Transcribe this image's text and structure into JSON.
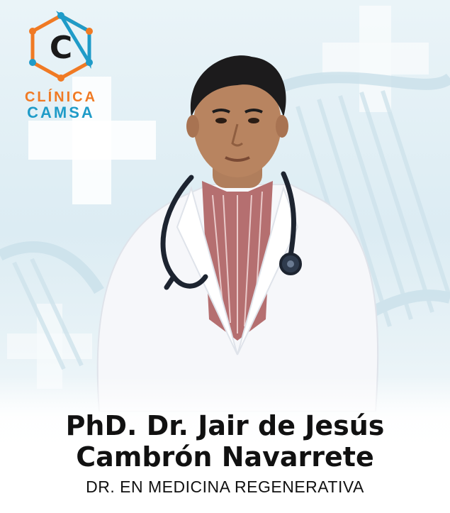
{
  "logo": {
    "letter": "C",
    "line1": "CLÍNICA",
    "line2": "CAMSA",
    "colors": {
      "orange": "#f07a24",
      "blue": "#1f9bc8",
      "dark": "#1a1a1a"
    }
  },
  "doctor": {
    "name_line1": "PhD. Dr. Jair de Jesús",
    "name_line2": "Cambrón Navarrete",
    "specialty": "DR. EN MEDICINA REGENERATIVA"
  },
  "background": {
    "primary": "#dcecf3",
    "decor": [
      "medical-cross",
      "dna-helix"
    ]
  }
}
